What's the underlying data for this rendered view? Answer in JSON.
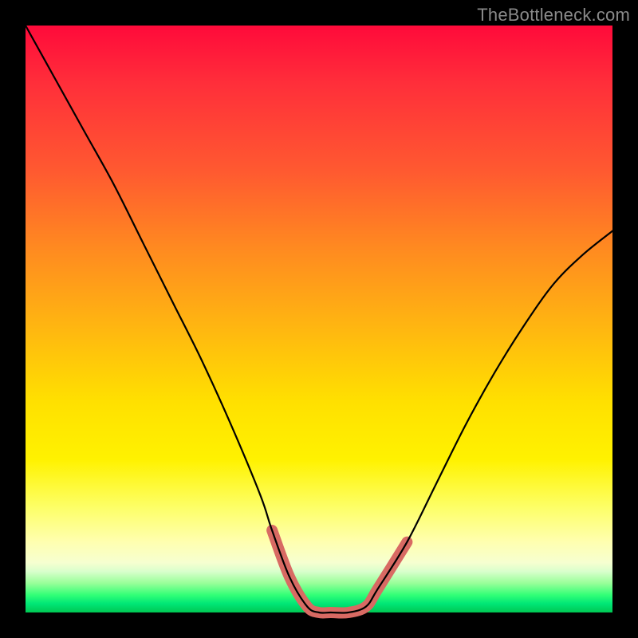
{
  "watermark": "TheBottleneck.com",
  "colors": {
    "frame": "#000000",
    "curve": "#000000",
    "emphasis": "#d86a63",
    "gradient_stops": [
      "#ff0a3a",
      "#ff5a30",
      "#ffb810",
      "#fff200",
      "#ffffb0",
      "#99ff99",
      "#00c853"
    ]
  },
  "chart_data": {
    "type": "line",
    "title": "",
    "xlabel": "",
    "ylabel": "",
    "xlim": [
      0,
      100
    ],
    "ylim": [
      0,
      100
    ],
    "x": [
      0,
      5,
      10,
      15,
      20,
      25,
      30,
      35,
      40,
      42,
      45,
      48,
      50,
      52,
      55,
      58,
      60,
      65,
      70,
      75,
      80,
      85,
      90,
      95,
      100
    ],
    "values": [
      100,
      91,
      82,
      73,
      63,
      53,
      43,
      32,
      20,
      14,
      6,
      1,
      0,
      0,
      0,
      1,
      4,
      12,
      22,
      32,
      41,
      49,
      56,
      61,
      65
    ],
    "emphasis_range_x": [
      44,
      60
    ],
    "note": "V-shaped bottleneck curve; minimum (0%) plateau roughly between x≈48 and x≈58; left arm steeper than right arm; right arm tops out near y≈65 at x=100."
  }
}
